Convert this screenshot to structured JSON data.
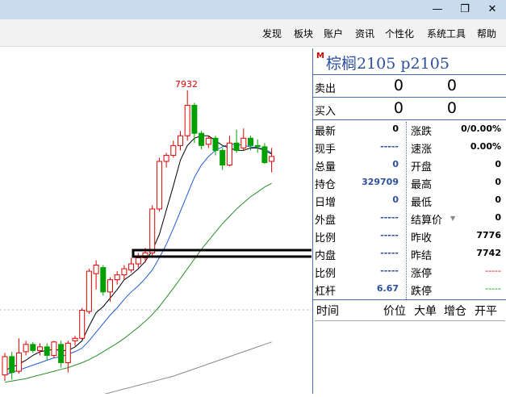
{
  "window": {
    "minimize_glyph": "—",
    "maximize_glyph": "❐",
    "close_glyph": "✕"
  },
  "menu": [
    "发现",
    "板块",
    "账户",
    "资讯",
    "个性化",
    "系统工具",
    "帮助"
  ],
  "chart": {
    "high_label": "7932",
    "colors": {
      "up": "#e00000",
      "down": "#00a000",
      "ma5": "#000000",
      "ma10": "#1f5bd6",
      "ma20": "#2a8f2a",
      "ma60": "#8a8a8a"
    }
  },
  "chart_data": {
    "type": "candlestick",
    "annotations": [
      "7932"
    ],
    "candles": [
      {
        "o": 5600,
        "c": 5750,
        "h": 5780,
        "l": 5550
      },
      {
        "o": 5750,
        "c": 5620,
        "h": 5790,
        "l": 5560
      },
      {
        "o": 5630,
        "c": 5780,
        "h": 5900,
        "l": 5610
      },
      {
        "o": 5790,
        "c": 5850,
        "h": 5880,
        "l": 5760
      },
      {
        "o": 5850,
        "c": 5800,
        "h": 5870,
        "l": 5780
      },
      {
        "o": 5800,
        "c": 5830,
        "h": 5860,
        "l": 5760
      },
      {
        "o": 5830,
        "c": 5760,
        "h": 5860,
        "l": 5720
      },
      {
        "o": 5760,
        "c": 5870,
        "h": 5880,
        "l": 5740
      },
      {
        "o": 5850,
        "c": 5700,
        "h": 5880,
        "l": 5660
      },
      {
        "o": 5700,
        "c": 5860,
        "h": 5880,
        "l": 5620
      },
      {
        "o": 5880,
        "c": 5900,
        "h": 5920,
        "l": 5840
      },
      {
        "o": 5900,
        "c": 6130,
        "h": 6150,
        "l": 5890
      },
      {
        "o": 6120,
        "c": 6450,
        "h": 6470,
        "l": 6100
      },
      {
        "o": 6430,
        "c": 6500,
        "h": 6540,
        "l": 6300
      },
      {
        "o": 6480,
        "c": 6280,
        "h": 6500,
        "l": 6250
      },
      {
        "o": 6280,
        "c": 6380,
        "h": 6400,
        "l": 6200
      },
      {
        "o": 6380,
        "c": 6420,
        "h": 6450,
        "l": 6340
      },
      {
        "o": 6420,
        "c": 6470,
        "h": 6500,
        "l": 6380
      },
      {
        "o": 6460,
        "c": 6510,
        "h": 6560,
        "l": 6440
      },
      {
        "o": 6510,
        "c": 6560,
        "h": 6600,
        "l": 6480
      },
      {
        "o": 6560,
        "c": 6600,
        "h": 6640,
        "l": 6520
      },
      {
        "o": 6600,
        "c": 6960,
        "h": 6990,
        "l": 6580
      },
      {
        "o": 6960,
        "c": 7350,
        "h": 7380,
        "l": 6940
      },
      {
        "o": 7350,
        "c": 7400,
        "h": 7420,
        "l": 7300
      },
      {
        "o": 7400,
        "c": 7480,
        "h": 7520,
        "l": 7380
      },
      {
        "o": 7480,
        "c": 7560,
        "h": 7600,
        "l": 7440
      },
      {
        "o": 7560,
        "c": 7810,
        "h": 7932,
        "l": 7520
      },
      {
        "o": 7810,
        "c": 7580,
        "h": 7830,
        "l": 7500
      },
      {
        "o": 7580,
        "c": 7480,
        "h": 7600,
        "l": 7450
      },
      {
        "o": 7490,
        "c": 7540,
        "h": 7560,
        "l": 7460
      },
      {
        "o": 7540,
        "c": 7440,
        "h": 7560,
        "l": 7400
      },
      {
        "o": 7440,
        "c": 7320,
        "h": 7460,
        "l": 7280
      },
      {
        "o": 7320,
        "c": 7500,
        "h": 7560,
        "l": 7310
      },
      {
        "o": 7500,
        "c": 7440,
        "h": 7610,
        "l": 7420
      },
      {
        "o": 7460,
        "c": 7540,
        "h": 7620,
        "l": 7440
      },
      {
        "o": 7540,
        "c": 7480,
        "h": 7560,
        "l": 7440
      },
      {
        "o": 7480,
        "c": 7470,
        "h": 7530,
        "l": 7420
      },
      {
        "o": 7470,
        "c": 7340,
        "h": 7500,
        "l": 7330
      },
      {
        "o": 7350,
        "c": 7390,
        "h": 7460,
        "l": 7260
      }
    ],
    "ma5": [
      5640,
      5660,
      5690,
      5720,
      5760,
      5790,
      5800,
      5810,
      5800,
      5800,
      5830,
      5880,
      6000,
      6110,
      6160,
      6230,
      6300,
      6380,
      6420,
      6470,
      6530,
      6620,
      6750,
      6950,
      7150,
      7360,
      7480,
      7540,
      7560,
      7560,
      7520,
      7480,
      7460,
      7440,
      7440,
      7460,
      7460,
      7440,
      7410
    ],
    "ma10": [
      5600,
      5620,
      5640,
      5660,
      5680,
      5700,
      5720,
      5740,
      5750,
      5770,
      5790,
      5820,
      5880,
      5950,
      6020,
      6090,
      6150,
      6220,
      6280,
      6330,
      6390,
      6460,
      6560,
      6670,
      6800,
      6940,
      7080,
      7220,
      7320,
      7390,
      7440,
      7470,
      7490,
      7490,
      7480,
      7470,
      7460,
      7450,
      7420
    ],
    "ma20": [
      5540,
      5550,
      5560,
      5570,
      5585,
      5600,
      5615,
      5630,
      5645,
      5660,
      5680,
      5700,
      5725,
      5755,
      5790,
      5825,
      5860,
      5900,
      5945,
      5990,
      6040,
      6095,
      6160,
      6235,
      6310,
      6390,
      6470,
      6550,
      6630,
      6700,
      6770,
      6840,
      6900,
      6960,
      7010,
      7060,
      7100,
      7140,
      7170
    ],
    "ma60": [
      5300,
      5310,
      5320,
      5330,
      5340,
      5350,
      5360,
      5370,
      5380,
      5390,
      5400,
      5410,
      5420,
      5430,
      5440,
      5455,
      5470,
      5485,
      5500,
      5515,
      5530,
      5545,
      5560,
      5575,
      5590,
      5610,
      5630,
      5650,
      5670,
      5690,
      5710,
      5730,
      5750,
      5770,
      5790,
      5810,
      5830,
      5850,
      5870
    ]
  },
  "quote": {
    "title": "棕榈2105  p2105",
    "logo": "M",
    "sell": {
      "label": "卖出",
      "price": "0",
      "volume": "0"
    },
    "buy": {
      "label": "买入",
      "price": "0",
      "volume": "0"
    },
    "left_rows": [
      {
        "label": "最新",
        "value": "0"
      },
      {
        "label": "现手",
        "value": "-----"
      },
      {
        "label": "总量",
        "value": "0"
      },
      {
        "label": "持仓",
        "value": "329709"
      },
      {
        "label": "日增",
        "value": "0"
      },
      {
        "label": "外盘",
        "value": "-----"
      },
      {
        "label": "比例",
        "value": "-----"
      },
      {
        "label": "内盘",
        "value": "-----"
      },
      {
        "label": "比例",
        "value": "-----"
      },
      {
        "label": "杠杆",
        "value": "6.67"
      }
    ],
    "right_rows": [
      {
        "label": "涨跌",
        "value": "0/0.00%"
      },
      {
        "label": "速涨",
        "value": "0.00%"
      },
      {
        "label": "开盘",
        "value": "0"
      },
      {
        "label": "最高",
        "value": "0"
      },
      {
        "label": "最低",
        "value": "0"
      },
      {
        "label": "结算价",
        "value": "0"
      },
      {
        "label": "昨收",
        "value": "7776"
      },
      {
        "label": "昨结",
        "value": "7742"
      },
      {
        "label": "涨停",
        "value": "-----"
      },
      {
        "label": "跌停",
        "value": "-----"
      }
    ],
    "tick_headers": [
      "时间",
      "价位",
      "大单",
      "增仓",
      "开平"
    ]
  }
}
